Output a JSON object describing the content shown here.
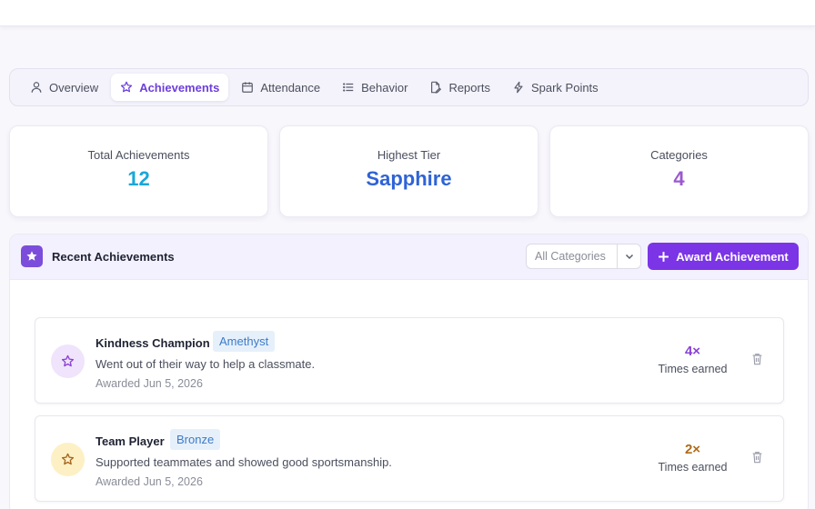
{
  "tabs": [
    {
      "label": "Overview",
      "icon": "user-icon"
    },
    {
      "label": "Achievements",
      "icon": "star-icon",
      "active": true
    },
    {
      "label": "Attendance",
      "icon": "calendar-icon"
    },
    {
      "label": "Behavior",
      "icon": "list-icon"
    },
    {
      "label": "Reports",
      "icon": "report-icon"
    },
    {
      "label": "Spark Points",
      "icon": "bolt-icon"
    }
  ],
  "stats": {
    "total": {
      "label": "Total Achievements",
      "value": "12",
      "color": "#1aa7d8"
    },
    "tier": {
      "label": "Highest Tier",
      "value": "Sapphire",
      "color": "#2f63d6"
    },
    "categories": {
      "label": "Categories",
      "value": "4",
      "color": "#9b59d0"
    }
  },
  "panel": {
    "title": "Recent Achievements",
    "filter": {
      "selected": "All Categories"
    },
    "award_button": "Award Achievement"
  },
  "achievements": [
    {
      "name": "Kindness Champion",
      "tier": "Amethyst",
      "description": "Went out of their way to help a classmate.",
      "awarded": "Awarded Jun 5, 2026",
      "count": "4×",
      "count_label": "Times earned",
      "icon": "star-icon",
      "accent": "#8a3fd6"
    },
    {
      "name": "Team Player",
      "tier": "Bronze",
      "description": "Supported teammates and showed good sportsmanship.",
      "awarded": "Awarded Jun 5, 2026",
      "count": "2×",
      "count_label": "Times earned",
      "icon": "star-icon",
      "accent": "#b06a17"
    }
  ]
}
